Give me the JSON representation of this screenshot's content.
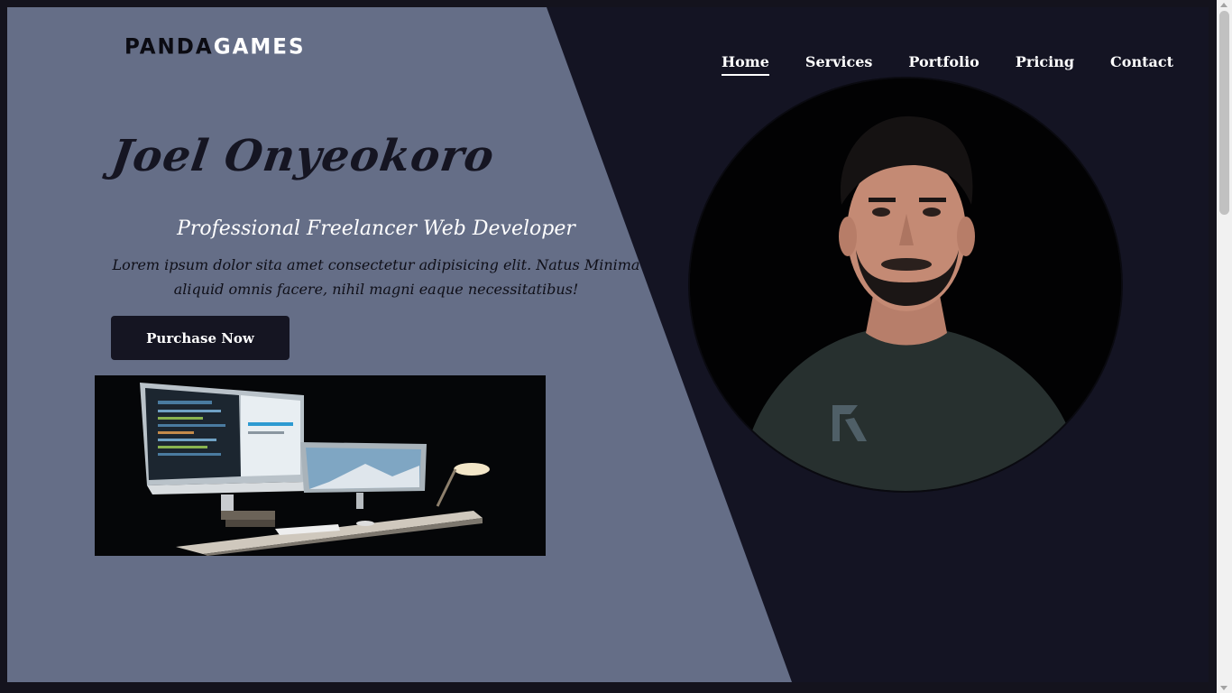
{
  "logo": {
    "part1": "PANDA",
    "part2": "GAMES"
  },
  "nav": {
    "items": [
      {
        "label": "Home",
        "active": true
      },
      {
        "label": "Services"
      },
      {
        "label": "Portfolio"
      },
      {
        "label": "Pricing"
      },
      {
        "label": "Contact"
      }
    ]
  },
  "hero": {
    "name": "Joel Onyeokoro",
    "subtitle": "Professional Freelancer Web Developer",
    "description": "Lorem ipsum dolor sita amet consectetur adipisicing elit. Natus Minima aliquid omnis facere, nihil magni eaque necessitatibus!",
    "cta_label": "Purchase Now"
  },
  "images": {
    "workspace": "workspace-photo",
    "portrait": "portrait-photo"
  },
  "colors": {
    "panel": "#656e87",
    "dark": "#141423",
    "button": "#151522",
    "text_light": "#ffffff"
  }
}
